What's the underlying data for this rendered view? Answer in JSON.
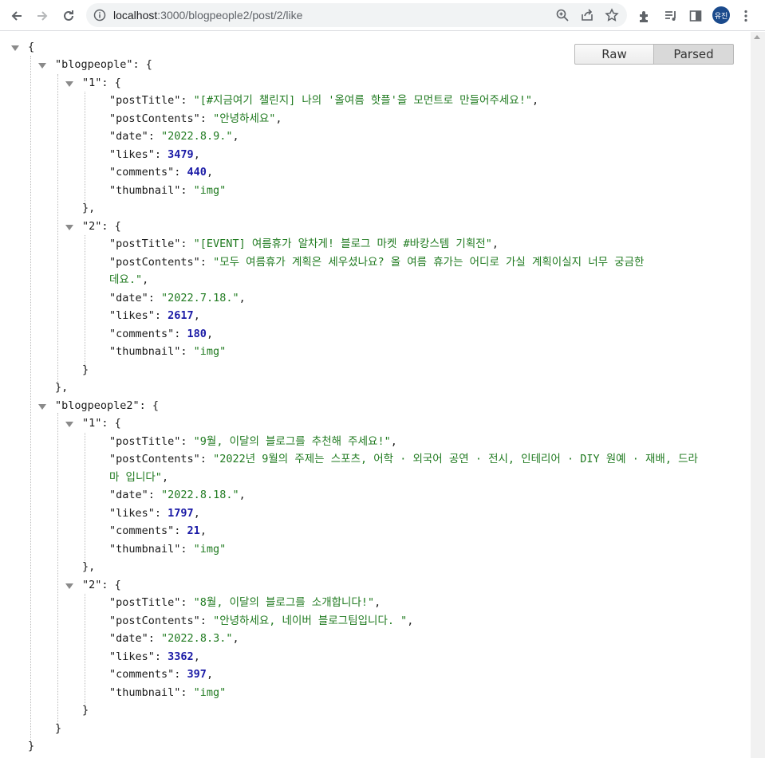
{
  "browser": {
    "url_host": "localhost",
    "url_path": ":3000/blogpeople2/post/2/like",
    "profile_initials": "유진"
  },
  "viewer": {
    "raw_label": "Raw",
    "parsed_label": "Parsed"
  },
  "json": {
    "blogpeople_key": "\"blogpeople\"",
    "blogpeople2_key": "\"blogpeople2\"",
    "bp1": {
      "key": "\"1\"",
      "postTitle": "\"[#지금여기 챌린지] 나의 '올여름 핫플'을 모먼트로 만들어주세요!\"",
      "postContents": "\"안녕하세요\"",
      "date": "\"2022.8.9.\"",
      "likes": "3479",
      "comments": "440",
      "thumbnail": "\"img\""
    },
    "bp2": {
      "key": "\"2\"",
      "postTitle": "\"[EVENT] 여름휴가 알차게! 블로그 마켓 #바캉스템 기획전\"",
      "postContents_1": "\"모두 여름휴가 계획은 세우셨나요? 올 여름 휴가는 어디로 가실 계획이실지 너무 궁금한",
      "postContents_2": "데요.\"",
      "date": "\"2022.7.18.\"",
      "likes": "2617",
      "comments": "180",
      "thumbnail": "\"img\""
    },
    "bpp1": {
      "key": "\"1\"",
      "postTitle": "\"9월, 이달의 블로그를 추천해 주세요!\"",
      "postContents_1": "\"2022년 9월의 주제는 스포츠, 어학 · 외국어 공연 · 전시, 인테리어 · DIY 원예 · 재배, 드라",
      "postContents_2": "마 입니다\"",
      "date": "\"2022.8.18.\"",
      "likes": "1797",
      "comments": "21",
      "thumbnail": "\"img\""
    },
    "bpp2": {
      "key": "\"2\"",
      "postTitle": "\"8월, 이달의 블로그를 소개합니다!\"",
      "postContents": "\"안녕하세요, 네이버 블로그팀입니다. \"",
      "date": "\"2022.8.3.\"",
      "likes": "3362",
      "comments": "397",
      "thumbnail": "\"img\""
    },
    "keys": {
      "postTitle": "\"postTitle\"",
      "postContents": "\"postContents\"",
      "date": "\"date\"",
      "likes": "\"likes\"",
      "comments": "\"comments\"",
      "thumbnail": "\"thumbnail\""
    }
  }
}
